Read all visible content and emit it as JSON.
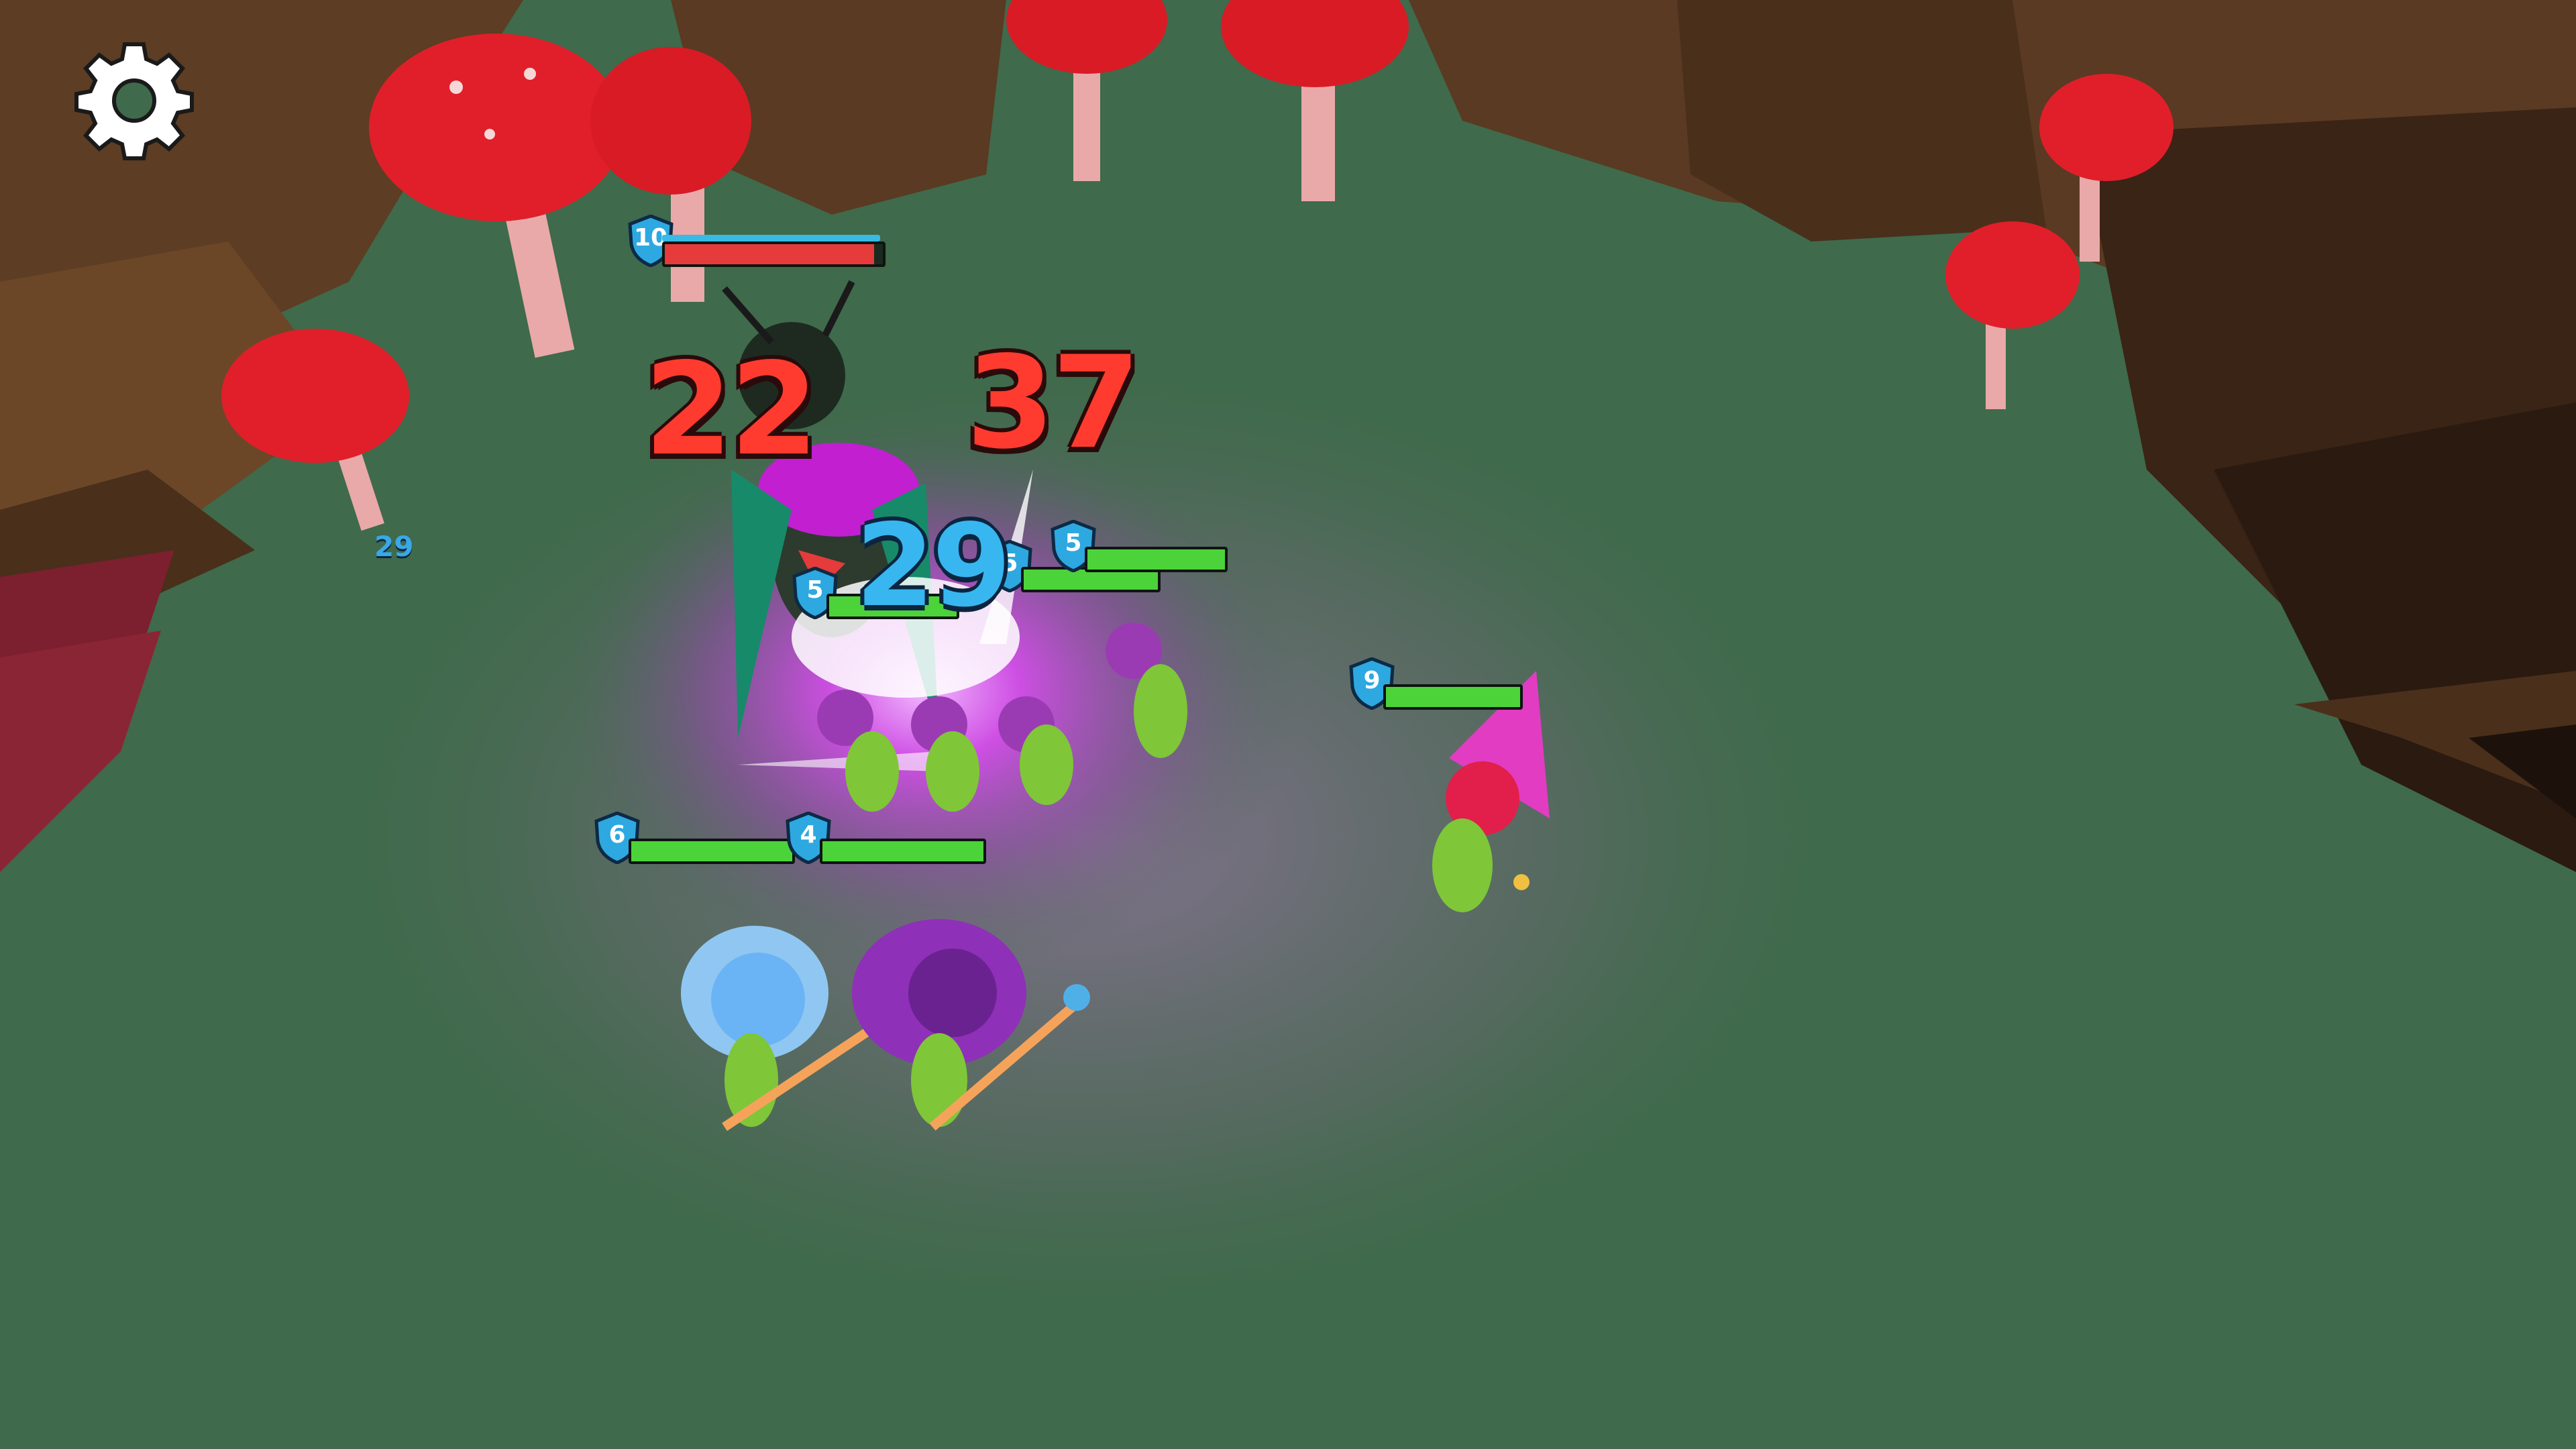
{
  "scene": {
    "background": "#3f6a4b",
    "glow_color": "#d94bf0",
    "mushroom_cap": "#e01f2a",
    "rock_color": "#5a3a22"
  },
  "hud": {
    "settings_icon": "gear-icon"
  },
  "enemies": [
    {
      "name": "boss-insect",
      "level": "10",
      "hp": 0.96,
      "hp_color": "#e53b3b"
    }
  ],
  "allies": [
    {
      "name": "goblin-a",
      "level": "5",
      "hp": 1.0,
      "hp_color": "#4cd33a"
    },
    {
      "name": "goblin-b",
      "level": "5",
      "hp": 1.0,
      "hp_color": "#4cd33a"
    },
    {
      "name": "goblin-c",
      "level": "5",
      "hp": 1.0,
      "hp_color": "#4cd33a"
    },
    {
      "name": "mage-pink",
      "level": "9",
      "hp": 1.0,
      "hp_color": "#4cd33a"
    },
    {
      "name": "mage-blue",
      "level": "6",
      "hp": 1.0,
      "hp_color": "#4cd33a"
    },
    {
      "name": "mage-purple",
      "level": "4",
      "hp": 1.0,
      "hp_color": "#4cd33a"
    }
  ],
  "damage_numbers": [
    {
      "value": "22",
      "style": "red"
    },
    {
      "value": "37",
      "style": "red"
    },
    {
      "value": "29",
      "style": "blue"
    },
    {
      "value": "29",
      "style": "small-blue"
    }
  ]
}
